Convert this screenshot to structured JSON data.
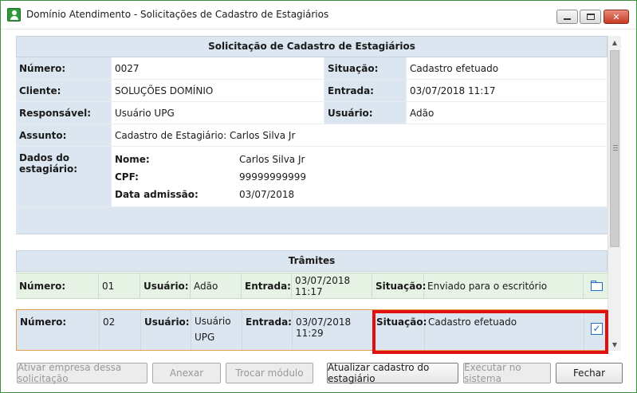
{
  "window": {
    "title": "Domínio Atendimento - Solicitações de Cadastro de Estagiários",
    "accent_color": "#2f9a3b"
  },
  "request": {
    "header": "Solicitação de Cadastro de Estagiários",
    "numero_label": "Número:",
    "numero": "0027",
    "situacao_label": "Situação:",
    "situacao": "Cadastro efetuado",
    "cliente_label": "Cliente:",
    "cliente": "SOLUÇÕES DOMÍNIO",
    "entrada_label": "Entrada:",
    "entrada": "03/07/2018 11:17",
    "responsavel_label": "Responsável:",
    "responsavel": "Usuário UPG",
    "usuario_label": "Usuário:",
    "usuario": "Adão",
    "assunto_label": "Assunto:",
    "assunto": "Cadastro de Estagiário: Carlos Silva Jr",
    "dados_label": "Dados do estagiário:",
    "nome_label": "Nome:",
    "nome": "Carlos Silva Jr",
    "cpf_label": "CPF:",
    "cpf": "99999999999",
    "admissao_label": "Data admissão:",
    "admissao": "03/07/2018"
  },
  "tramites": {
    "header": "Trâmites",
    "rows": [
      {
        "numero_label": "Número:",
        "numero": "01",
        "usuario_label": "Usuário:",
        "usuario": "Adão",
        "entrada_label": "Entrada:",
        "entrada": "03/07/2018 11:17",
        "situacao_label": "Situação:",
        "situacao": "Enviado para o escritório",
        "icon": "folder-icon"
      },
      {
        "numero_label": "Número:",
        "numero": "02",
        "usuario_label": "Usuário:",
        "usuario_line1": "Usuário",
        "usuario_line2": "UPG",
        "entrada_label": "Entrada:",
        "entrada": "03/07/2018 11:29",
        "situacao_label": "Situação:",
        "situacao": "Cadastro efetuado",
        "icon": "checkbox-icon"
      }
    ]
  },
  "buttons": {
    "ativar": "Ativar empresa dessa solicitação",
    "anexar": "Anexar",
    "trocar": "Trocar módulo",
    "atualizar": "Atualizar cadastro do estagiário",
    "executar": "Executar no sistema",
    "fechar": "Fechar"
  }
}
